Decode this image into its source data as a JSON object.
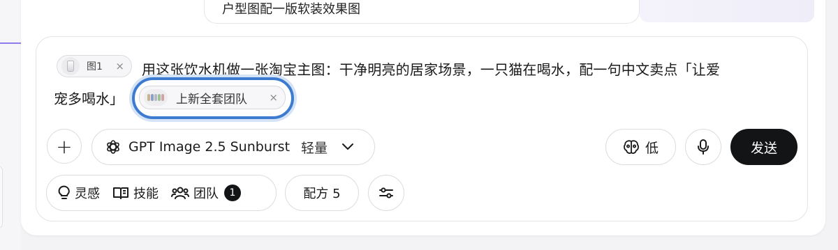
{
  "previous_message": {
    "text": "户型图配一版软装效果图"
  },
  "composer": {
    "attachment_chip": {
      "label": "图1",
      "close": "×",
      "thumb_icon": "water-dispenser-thumbnail"
    },
    "prompt_line1": "用这张饮水机做一张淘宝主图：干净明亮的居家场景，一只猫在喝水，配一句中文卖点「让爱",
    "prompt_line2": "宠多喝水」",
    "team_chip": {
      "label": "上新全套团队",
      "close": "×"
    }
  },
  "toolbar": {
    "plus_label": "+",
    "model": {
      "name": "GPT Image 2.5 Sunburst",
      "tier": "轻量"
    },
    "thinking": {
      "label": "低"
    },
    "send_label": "发送"
  },
  "bottom_bar": {
    "inspiration_label": "灵感",
    "skills_label": "技能",
    "team_label": "团队",
    "team_count": "1",
    "recipe_label": "配方 5"
  },
  "colors": {
    "focus_ring": "#3d7bd1",
    "send_bg": "#131416",
    "accent_line": "#8f7df0"
  }
}
